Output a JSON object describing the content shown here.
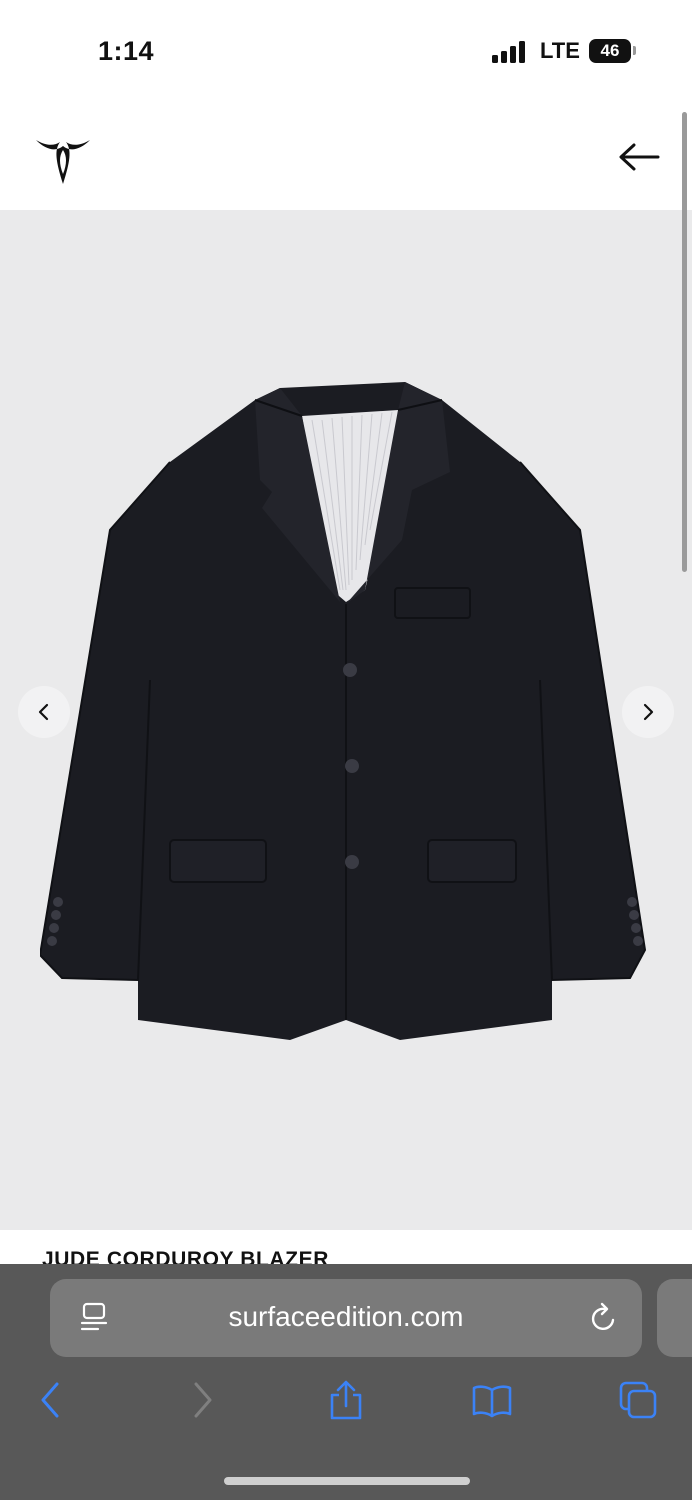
{
  "status_bar": {
    "time": "1:14",
    "network": "LTE",
    "battery": "46"
  },
  "product": {
    "title": "JUDE CORDUROY BLAZER"
  },
  "browser": {
    "url": "surfaceedition.com"
  },
  "icons": {
    "logo": "brand-logo-icon",
    "back": "back-arrow-icon",
    "prev": "chevron-left-icon",
    "next": "chevron-right-icon",
    "reader": "page-menu-icon",
    "reload": "reload-icon",
    "toolbar": [
      "back-icon",
      "forward-icon",
      "share-icon",
      "bookmarks-icon",
      "tabs-icon"
    ]
  },
  "colors": {
    "accent": "#3b82f6",
    "image_background": "#eaeaeb",
    "toolbar": "#585858"
  }
}
